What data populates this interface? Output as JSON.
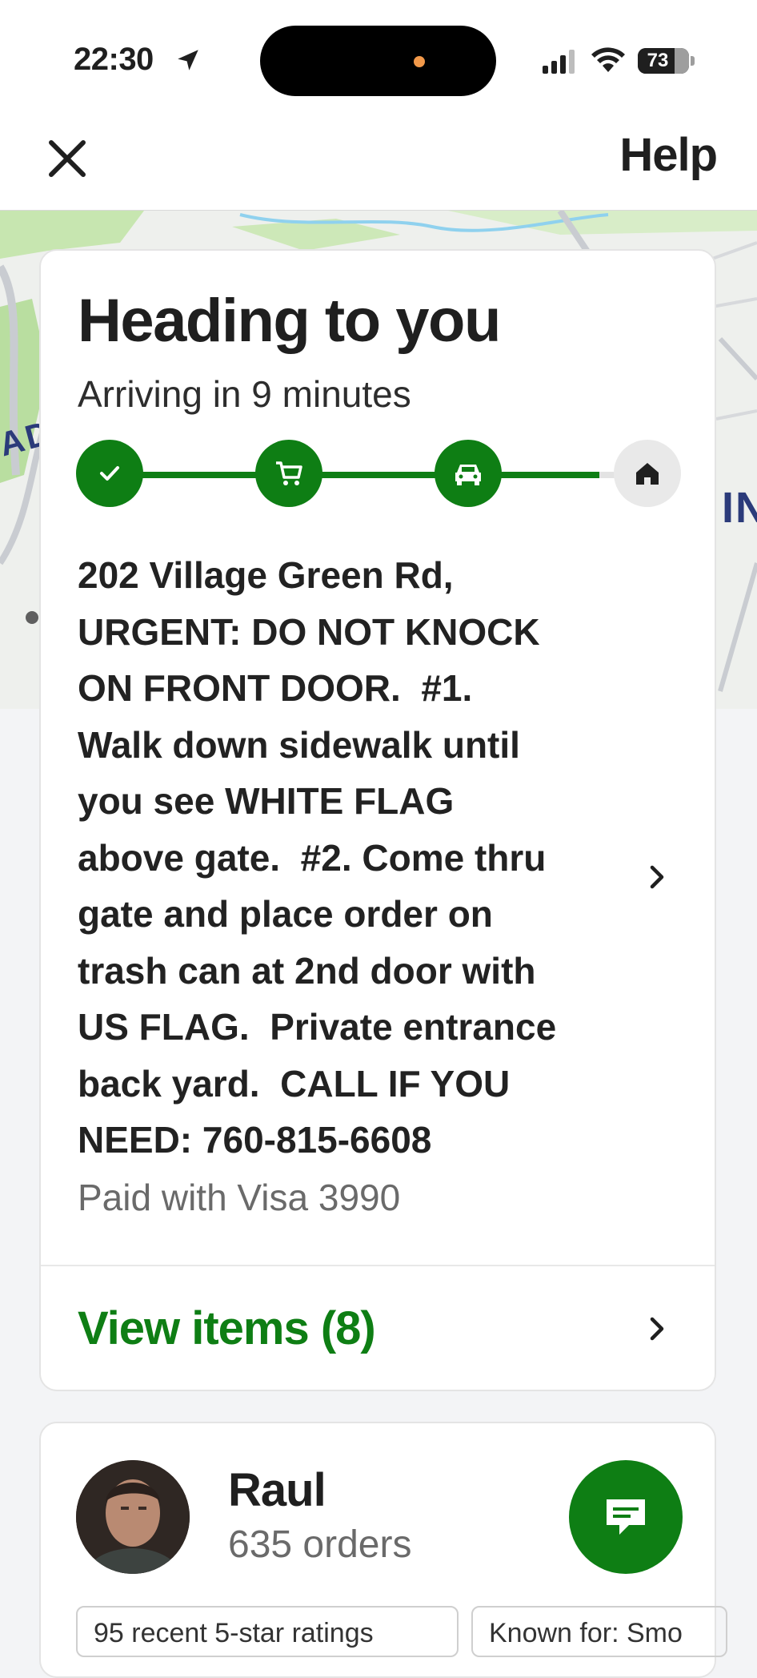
{
  "status_bar": {
    "time": "22:30",
    "battery": "73",
    "icons": [
      "location-arrow-icon",
      "signal-icon",
      "wifi-icon",
      "battery-icon"
    ]
  },
  "header": {
    "close_icon": "close-icon",
    "help_label": "Help"
  },
  "map": {
    "label_left": "ADIA",
    "label_right": "IN"
  },
  "tracking": {
    "title": "Heading to you",
    "subtitle": "Arriving in 9 minutes",
    "progress_steps": [
      {
        "icon": "check-icon",
        "state": "done"
      },
      {
        "icon": "cart-icon",
        "state": "done"
      },
      {
        "icon": "car-icon",
        "state": "done"
      },
      {
        "icon": "home-icon",
        "state": "pending"
      }
    ],
    "progress_fraction": 0.9,
    "address": "202 Village Green Rd,\nURGENT: DO NOT KNOCK\nON FRONT DOOR.  #1.\nWalk down sidewalk until\nyou see WHITE FLAG\nabove gate.  #2. Come thru\ngate and place order on\ntrash can at 2nd door with\nUS FLAG.  Private entrance\nback yard.  CALL IF YOU\nNEED: 760-815-6608",
    "payment": "Paid with Visa 3990",
    "view_items_label": "View items (8)"
  },
  "driver": {
    "name": "Raul",
    "orders": "635 orders",
    "chips": [
      "95 recent 5-star ratings",
      "Known for: Smo"
    ]
  },
  "colors": {
    "accent_green": "#0e7e14",
    "pending_gray": "#e9e9e9",
    "page_bg": "#f3f4f6"
  }
}
